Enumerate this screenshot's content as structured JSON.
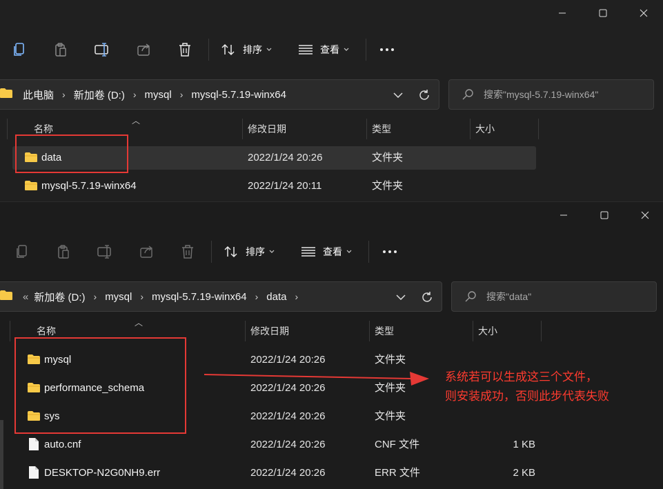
{
  "window1": {
    "toolbar": {
      "sort_label": "排序",
      "view_label": "查看"
    },
    "address": {
      "crumbs": [
        "此电脑",
        "新加卷 (D:)",
        "mysql",
        "mysql-5.7.19-winx64"
      ]
    },
    "search": {
      "placeholder": "搜索\"mysql-5.7.19-winx64\""
    },
    "columns": {
      "name": "名称",
      "modified": "修改日期",
      "type": "类型",
      "size": "大小"
    },
    "rows": [
      {
        "name": "data",
        "modified": "2022/1/24 20:26",
        "type": "文件夹",
        "size": ""
      },
      {
        "name": "mysql-5.7.19-winx64",
        "modified": "2022/1/24 20:11",
        "type": "文件夹",
        "size": ""
      }
    ]
  },
  "window2": {
    "toolbar": {
      "sort_label": "排序",
      "view_label": "查看"
    },
    "address": {
      "overflow": "«",
      "crumbs": [
        "新加卷 (D:)",
        "mysql",
        "mysql-5.7.19-winx64",
        "data"
      ]
    },
    "search": {
      "placeholder": "搜索\"data\""
    },
    "columns": {
      "name": "名称",
      "modified": "修改日期",
      "type": "类型",
      "size": "大小"
    },
    "rows": [
      {
        "name": "mysql",
        "modified": "2022/1/24 20:26",
        "type": "文件夹",
        "size": "",
        "icon": "folder-icon"
      },
      {
        "name": "performance_schema",
        "modified": "2022/1/24 20:26",
        "type": "文件夹",
        "size": "",
        "icon": "folder-icon"
      },
      {
        "name": "sys",
        "modified": "2022/1/24 20:26",
        "type": "文件夹",
        "size": "",
        "icon": "folder-icon"
      },
      {
        "name": "auto.cnf",
        "modified": "2022/1/24 20:26",
        "type": "CNF 文件",
        "size": "1 KB",
        "icon": "file-icon"
      },
      {
        "name": "DESKTOP-N2G0NH9.err",
        "modified": "2022/1/24 20:26",
        "type": "ERR 文件",
        "size": "2 KB",
        "icon": "file-icon"
      }
    ]
  },
  "annotation": {
    "line1": "系统若可以生成这三个文件，",
    "line2": "则安装成功，否则此步代表失败",
    "color": "#ff3b2f"
  },
  "colors": {
    "folder": "#f7c948",
    "highlight": "#e53935",
    "background": "#202020"
  }
}
